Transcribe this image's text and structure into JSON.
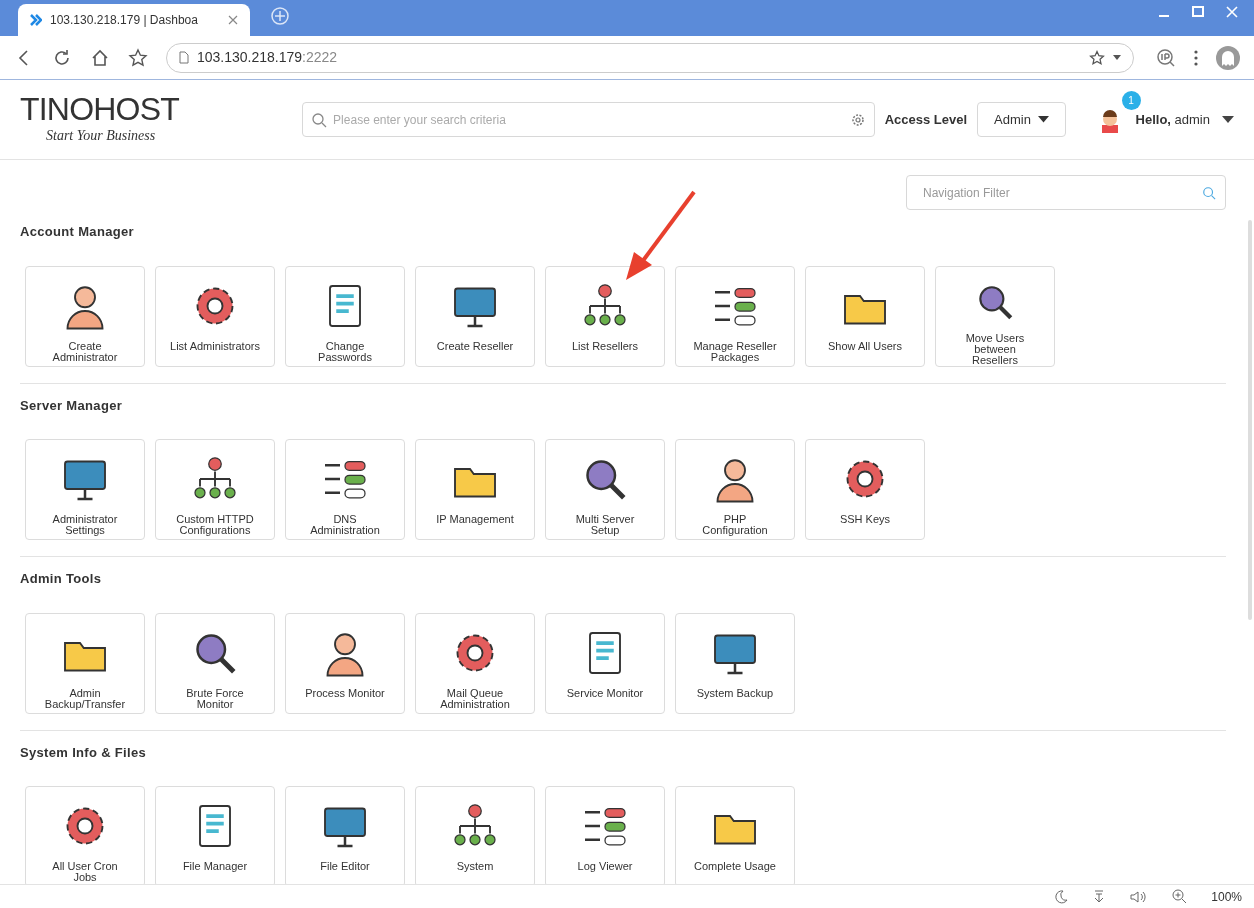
{
  "browser": {
    "tab_title": "103.130.218.179 | Dashboa",
    "url_host": "103.130.218.179",
    "url_port": ":2222",
    "zoom": "100%"
  },
  "header": {
    "logo_text": "TINOHOST",
    "logo_tagline": "Start Your Business",
    "search": {
      "placeholder": "Please enter your search criteria"
    },
    "access_label": "Access Level",
    "access_value": "Admin",
    "notification_count": "1",
    "greeting": "Hello,",
    "user": "admin"
  },
  "nav_filter": {
    "placeholder": "Navigation Filter"
  },
  "sections": [
    {
      "title": "Account Manager",
      "items": [
        "Create Administrator",
        "List Administrators",
        "Change Passwords",
        "Create Reseller",
        "List Resellers",
        "Manage Reseller Packages",
        "Show All Users",
        "Move Users between Resellers"
      ]
    },
    {
      "title": "Server Manager",
      "items": [
        "Administrator Settings",
        "Custom HTTPD Configurations",
        "DNS Administration",
        "IP Management",
        "Multi Server Setup",
        "PHP Configuration",
        "SSH Keys"
      ]
    },
    {
      "title": "Admin Tools",
      "items": [
        "Admin Backup/Transfer",
        "Brute Force Monitor",
        "Process Monitor",
        "Mail Queue Administration",
        "Service Monitor",
        "System Backup"
      ]
    },
    {
      "title": "System Info & Files",
      "items": [
        "All User Cron Jobs",
        "File Manager",
        "File Editor",
        "System",
        "Log Viewer",
        "Complete Usage"
      ]
    }
  ]
}
